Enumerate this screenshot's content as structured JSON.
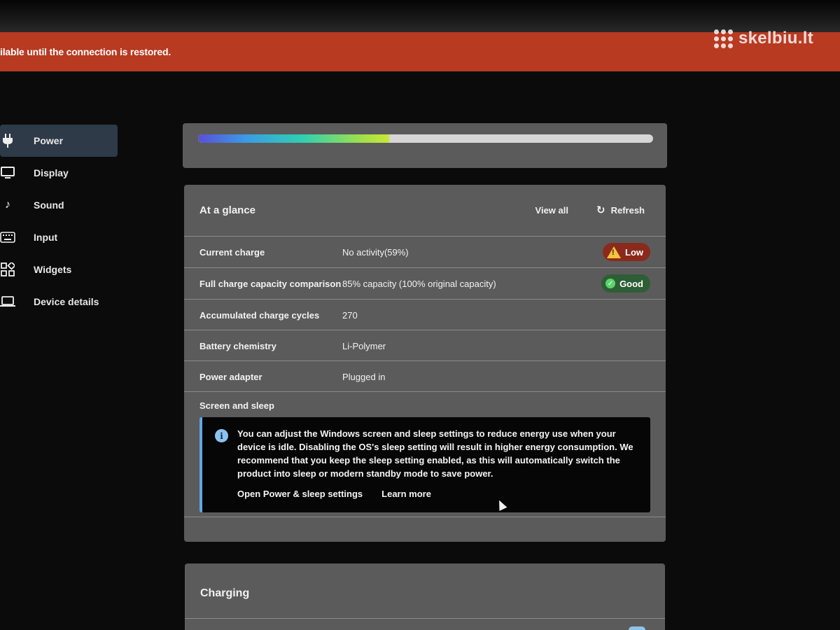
{
  "banner": {
    "text": "ilable until the connection is restored."
  },
  "watermark": {
    "text": "skelbiu.lt"
  },
  "sidebar": {
    "items": [
      {
        "label": "Power",
        "icon": "plug-icon",
        "active": true
      },
      {
        "label": "Display",
        "icon": "monitor-icon",
        "active": false
      },
      {
        "label": "Sound",
        "icon": "music-note-icon",
        "active": false
      },
      {
        "label": "Input",
        "icon": "keyboard-icon",
        "active": false
      },
      {
        "label": "Widgets",
        "icon": "widgets-icon",
        "active": false
      },
      {
        "label": "Device details",
        "icon": "laptop-icon",
        "active": false
      }
    ]
  },
  "battery_bar": {
    "level": 0.42
  },
  "glance": {
    "title": "At a glance",
    "view_all": "View all",
    "refresh": "Refresh",
    "rows": [
      {
        "label": "Current charge",
        "value": "No activity(59%)",
        "badge": "Low"
      },
      {
        "label": "Full charge capacity comparison",
        "value": "85% capacity (100% original capacity)",
        "badge": "Good"
      },
      {
        "label": "Accumulated charge cycles",
        "value": "270"
      },
      {
        "label": "Battery chemistry",
        "value": "Li-Polymer"
      },
      {
        "label": "Power adapter",
        "value": "Plugged in"
      }
    ],
    "screen_sleep": {
      "title": "Screen and sleep",
      "info": "You can adjust the Windows screen and sleep settings to reduce energy use when your device is idle. Disabling the OS's sleep setting will result in higher energy consumption. We recommend that you keep the sleep setting enabled, as this will automatically switch the product into sleep or modern standby mode to save power.",
      "open_settings": "Open Power & sleep settings",
      "learn_more": "Learn more"
    }
  },
  "charging": {
    "title": "Charging"
  },
  "colors": {
    "banner": "#b83a21",
    "card": "#5b5b5b",
    "low_badge": "#8b2a1c",
    "good_badge": "#2e5e35",
    "info_accent": "#63a7e6"
  }
}
